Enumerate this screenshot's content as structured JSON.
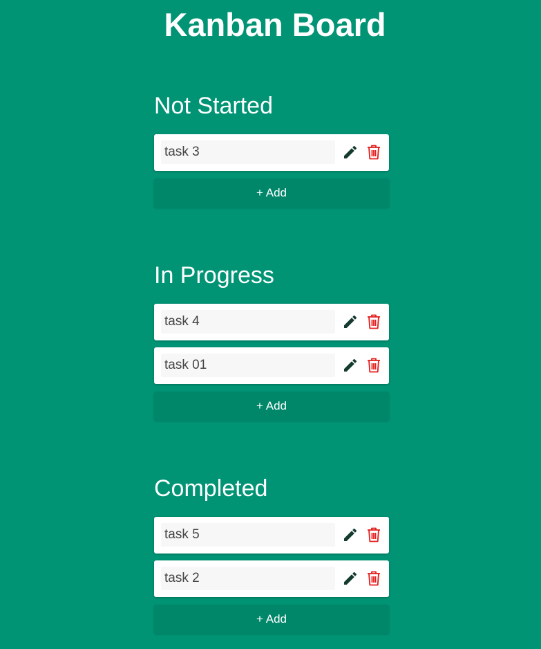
{
  "header": {
    "title": "Kanban Board"
  },
  "columns": [
    {
      "title": "Not Started",
      "tasks": [
        {
          "text": "task 3"
        }
      ],
      "add_label": "+ Add"
    },
    {
      "title": "In Progress",
      "tasks": [
        {
          "text": "task 4"
        },
        {
          "text": "task 01"
        }
      ],
      "add_label": "+ Add"
    },
    {
      "title": "Completed",
      "tasks": [
        {
          "text": "task 5"
        },
        {
          "text": "task 2"
        }
      ],
      "add_label": "+ Add"
    }
  ],
  "icons": {
    "edit": "pencil-icon",
    "delete": "trash-icon"
  },
  "colors": {
    "background": "#009475",
    "add_button": "#00876a",
    "card": "#ffffff",
    "input": "#f7f7f7",
    "edit_icon": "#143b2f",
    "delete_icon": "#e31b1b"
  }
}
